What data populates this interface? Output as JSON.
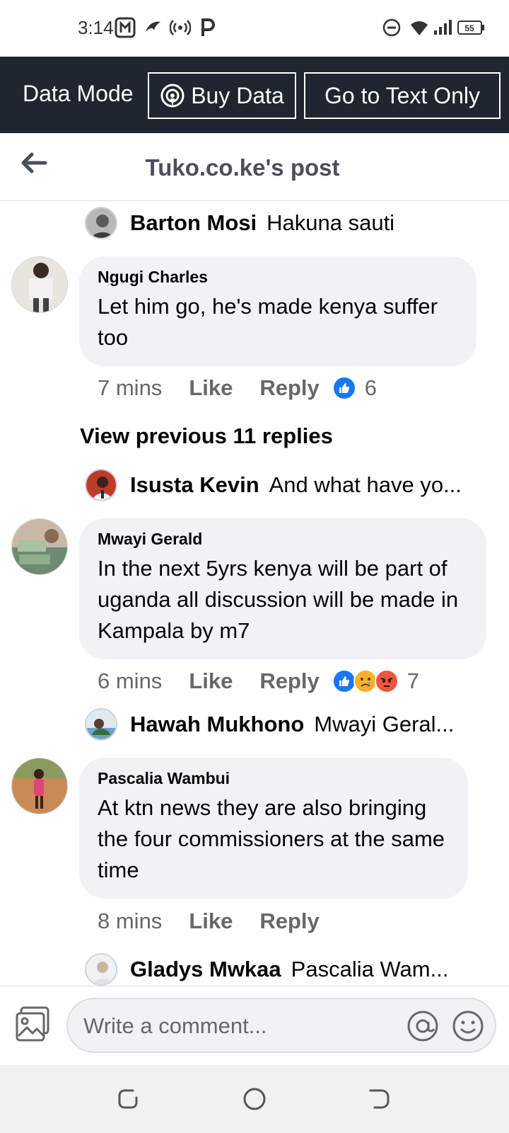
{
  "status_bar": {
    "time": "3:14",
    "battery": "55",
    "icons": [
      "app-icon",
      "bird-icon",
      "hotspot-icon",
      "parking-p-icon",
      "do-not-disturb-icon",
      "wifi-icon",
      "signal-icon",
      "battery-icon"
    ]
  },
  "banner": {
    "data_mode_label": "Data Mode",
    "buy_data_label": "Buy Data",
    "text_only_label": "Go to Text Only",
    "background": "#1f2630"
  },
  "header": {
    "title": "Tuko.co.ke's post"
  },
  "comments": [
    {
      "reply_preview": {
        "name": "Barton Mosi",
        "text": "Hakuna sauti"
      }
    },
    {
      "author": "Ngugi Charles",
      "text": "Let him go, he's made kenya suffer too",
      "time": "7 mins",
      "like_label": "Like",
      "reply_label": "Reply",
      "reactions": [
        "like"
      ],
      "reaction_count": "6"
    },
    {
      "view_previous": "View previous 11 replies"
    },
    {
      "reply_preview": {
        "name": "Isusta Kevin",
        "text": "And what have yo..."
      }
    },
    {
      "author": "Mwayi Gerald",
      "text": "In the next 5yrs kenya will be part of uganda all discussion  will be made in Kampala  by m7",
      "time": "6 mins",
      "like_label": "Like",
      "reply_label": "Reply",
      "reactions": [
        "like",
        "sad",
        "angry"
      ],
      "reaction_count": "7"
    },
    {
      "reply_preview": {
        "name": "Hawah Mukhono",
        "text": "Mwayi Geral..."
      }
    },
    {
      "author": "Pascalia Wambui",
      "text": "At ktn news they are also bringing the four commissioners at the same time",
      "time": "8 mins",
      "like_label": "Like",
      "reply_label": "Reply"
    },
    {
      "reply_preview": {
        "name": "Gladys Mwkaa",
        "text": "Pascalia Wam..."
      }
    }
  ],
  "composer": {
    "placeholder": "Write a comment..."
  },
  "colors": {
    "accent": "#1877f2",
    "bubble": "#f0f2f5",
    "secondary_text": "#65676b"
  }
}
